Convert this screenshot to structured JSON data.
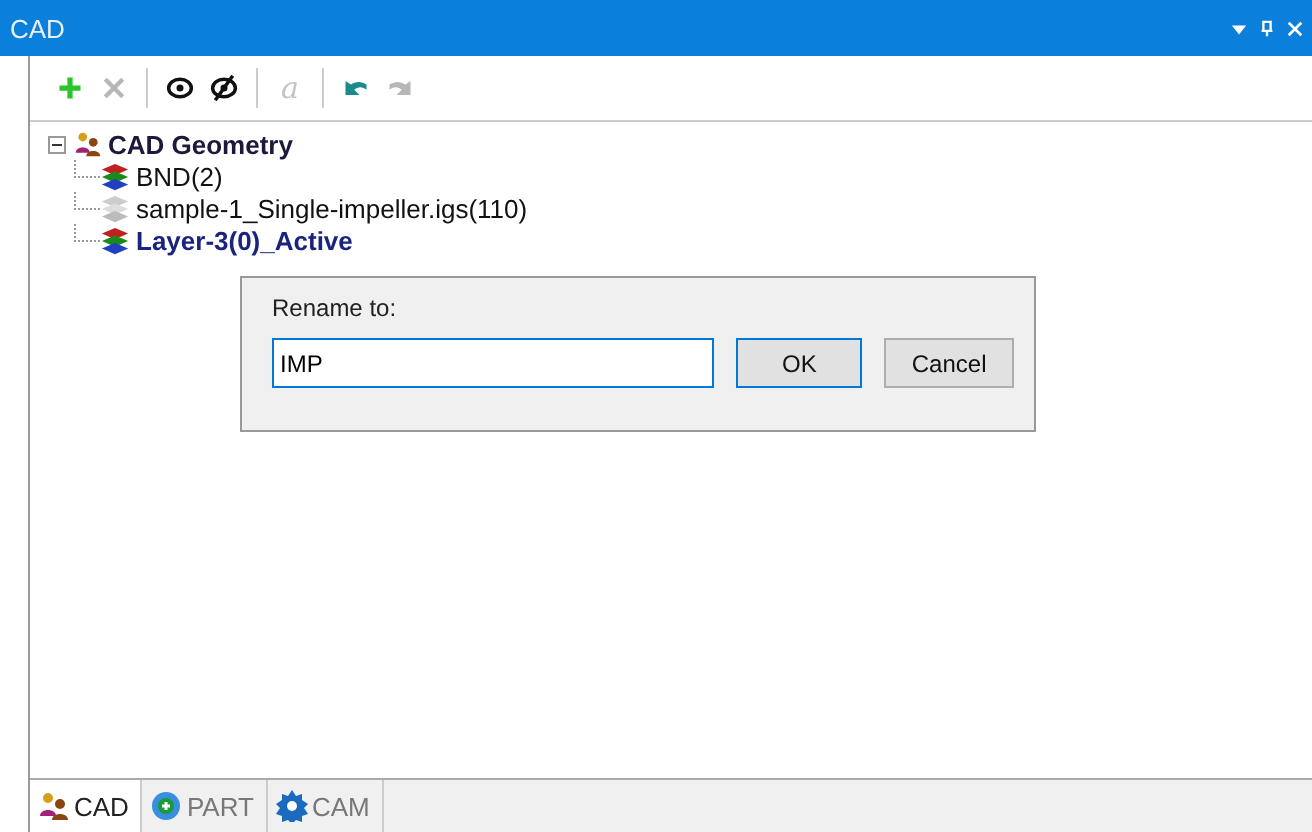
{
  "window": {
    "title": "CAD"
  },
  "toolbar": [
    {
      "kind": "add",
      "disabled": false
    },
    {
      "kind": "delete",
      "disabled": true
    },
    {
      "kind": "show",
      "disabled": false
    },
    {
      "kind": "hide",
      "disabled": false
    },
    {
      "kind": "rename",
      "label": "a",
      "disabled": true
    },
    {
      "kind": "undo",
      "disabled": false
    },
    {
      "kind": "redo",
      "disabled": true
    }
  ],
  "tree": {
    "label": "CAD Geometry",
    "expanded": true,
    "children": [
      {
        "label": "BND(2)",
        "visible": true,
        "active": false
      },
      {
        "label": "sample-1_Single-impeller.igs(110)",
        "visible": false,
        "active": false
      },
      {
        "label": "Layer-3(0)_Active",
        "visible": true,
        "active": true
      }
    ]
  },
  "dialog": {
    "label": "Rename to:",
    "value": "IMP",
    "buttons": [
      {
        "label": "OK",
        "default": true
      },
      {
        "label": "Cancel",
        "default": false
      }
    ]
  },
  "tabs": [
    {
      "label": "CAD",
      "kind": "cad",
      "selected": true
    },
    {
      "label": "PART",
      "kind": "part",
      "selected": false
    },
    {
      "label": "CAM",
      "kind": "cam",
      "selected": false
    }
  ]
}
